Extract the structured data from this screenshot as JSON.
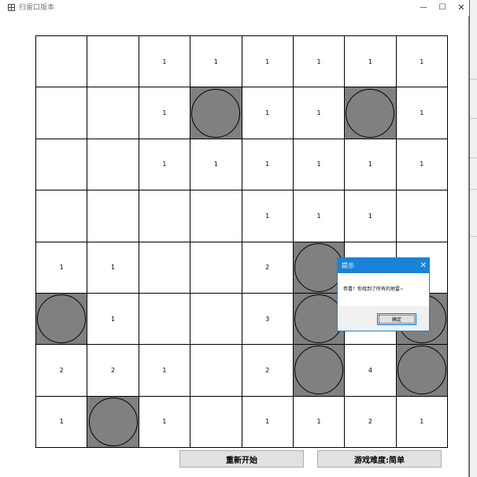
{
  "window": {
    "title": "扫雷口版本",
    "minimize_glyph": "—",
    "maximize_glyph": "☐",
    "close_glyph": "✕"
  },
  "board": {
    "rows": [
      [
        "",
        "",
        "1",
        "1",
        "1",
        "1",
        "1",
        "1"
      ],
      [
        "",
        "",
        "1",
        "M",
        "1",
        "1",
        "M",
        "1"
      ],
      [
        "",
        "",
        "1",
        "1",
        "1",
        "1",
        "1",
        "1"
      ],
      [
        "",
        "",
        "",
        "",
        "1",
        "1",
        "1",
        ""
      ],
      [
        "1",
        "1",
        "",
        "",
        "2",
        "M",
        "",
        ""
      ],
      [
        "M",
        "1",
        "",
        "",
        "3",
        "M",
        "",
        "M"
      ],
      [
        "2",
        "2",
        "1",
        "",
        "2",
        "M",
        "4",
        "M"
      ],
      [
        "1",
        "M",
        "1",
        "",
        "1",
        "1",
        "2",
        "1"
      ]
    ]
  },
  "buttons": {
    "restart": "重新开始",
    "difficulty": "游戏难度:简单"
  },
  "dialog": {
    "title": "提示",
    "close_glyph": "✕",
    "message": "恭喜！你找到了所有的地雷~",
    "ok": "确定"
  },
  "colors": {
    "mine_fill": "#808080",
    "dialog_accent": "#1883d7",
    "background_desktop": "#3a6ea5"
  }
}
